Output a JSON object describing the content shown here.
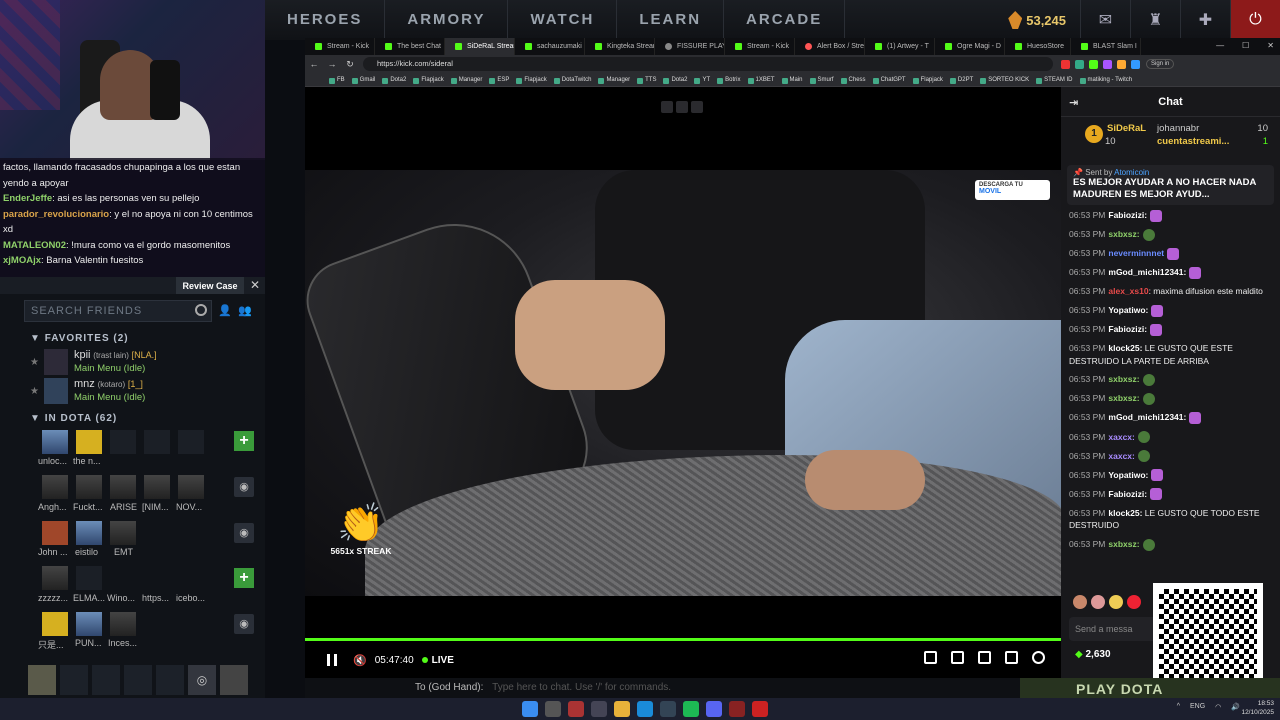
{
  "dota": {
    "nav": [
      "HEROES",
      "ARMORY",
      "WATCH",
      "LEARN",
      "ARCADE"
    ],
    "shards": "53,245"
  },
  "left_chat": [
    {
      "user": "",
      "text": "factos, llamando fracasados chupapinga a los que estan yendo a apoyar",
      "color": "#ffffff"
    },
    {
      "user": "EnderJeffe",
      "text": ": asi es las personas ven su pellejo",
      "color": "#8fd16a"
    },
    {
      "user": "parador_revolucionario",
      "text": ": y el no apoya ni con 10 centimos xd",
      "color": "#d9a34a"
    },
    {
      "user": "MATALEON02",
      "text": ": !mura como va el gordo masomenitos",
      "color": "#8fd16a"
    },
    {
      "user": "xjMOAjx",
      "text": ": Barna Valentin fuesitos",
      "color": "#8fd16a"
    }
  ],
  "friends": {
    "review_case": "Review Case",
    "search_placeholder": "SEARCH FRIENDS",
    "favorites_label": "FAVORITES (2)",
    "favorites": [
      {
        "name": "kpii",
        "sub": "(trast lain)",
        "tag": "[NLA.]",
        "status": "Main Menu (Idle)"
      },
      {
        "name": "mnz",
        "sub": "(kotaro)",
        "tag": "[1_]",
        "status": "Main Menu (Idle)"
      }
    ],
    "in_dota_label": "IN DOTA (62)",
    "tiles_row1": [
      "unloc...",
      "the n..."
    ],
    "tiles_row2": [
      "Angh...",
      "Fuckt...",
      "ARISE",
      "[NIM...",
      "NOV..."
    ],
    "tiles_row3": [
      "John ...",
      "eistilo",
      "EMT"
    ],
    "tiles_row4": [
      "zzzzz...",
      "ELMA...",
      "Wino...",
      "https...",
      "icebo..."
    ],
    "tiles_row5": [
      "只是...",
      "PUN...",
      "Inces..."
    ]
  },
  "browser": {
    "tabs": [
      "Stream - Kick",
      "The best Chat",
      "SiDeRaL Stream",
      "sachauzumaki",
      "Kingteka Stream",
      "FISSURE PLAYS",
      "Stream - Kick",
      "Alert Box / Stre",
      "(1) Artwey - T",
      "Ogre Magi - D",
      "HuesoStore",
      "BLAST Slam I"
    ],
    "url": "https://kick.com/sideral",
    "signin": "Sign in",
    "bookmarks": [
      "FB",
      "Gmail",
      "Dota2",
      "Flapjack",
      "Manager",
      "ESP",
      "Flapjack",
      "DotaTwitch",
      "Manager",
      "TTS",
      "Dota2",
      "YT",
      "Botrix",
      "1XBET",
      "Main",
      "Smurf",
      "Chess",
      "ChatGPT",
      "Flapjack",
      "D2PT",
      "SORTEO KICK",
      "STEAM ID",
      "matiking - Twitch"
    ]
  },
  "video": {
    "badge": "DESCARGA TU",
    "badge_sub": "MOVIL",
    "streak": "5651x STREAK",
    "time": "05:47:40",
    "live": "LIVE",
    "progress": 1.0
  },
  "chat": {
    "title": "Chat",
    "leaders": [
      {
        "name": "SiDeRaL",
        "count": "10"
      },
      {
        "name": "johannabr",
        "count": "10"
      },
      {
        "name": "cuentastreami...",
        "count": "1"
      }
    ],
    "pinned_sent_by": "Sent by",
    "pinned_author": "Atomicoin",
    "pinned_msg": "ES MEJOR AYUDAR A NO HACER NADA MADUREN ES MEJOR AYUD...",
    "messages": [
      {
        "ts": "06:53 PM",
        "user": "Fabiozizi:",
        "color": "#ffffff",
        "text": "",
        "emote": true
      },
      {
        "ts": "06:53 PM",
        "user": "sxbxsz:",
        "color": "#8fd16a",
        "text": "",
        "emote": true
      },
      {
        "ts": "06:53 PM",
        "user": "neverminnnet",
        "color": "#6a8cff",
        "text": "",
        "emote": true
      },
      {
        "ts": "06:53 PM",
        "user": "mGod_michi12341:",
        "color": "#ffffff",
        "text": "",
        "emote": true
      },
      {
        "ts": "06:53 PM",
        "user": "alex_xs10",
        "color": "#e84a4a",
        "text": ": maxima difusion este maldito",
        "emote": false
      },
      {
        "ts": "06:53 PM",
        "user": "Yopatiwo:",
        "color": "#ffffff",
        "text": "",
        "emote": true
      },
      {
        "ts": "06:53 PM",
        "user": "Fabiozizi:",
        "color": "#ffffff",
        "text": "",
        "emote": true
      },
      {
        "ts": "06:53 PM",
        "user": "klock25:",
        "color": "#ffffff",
        "text": " LE GUSTO QUE ESTE DESTRUIDO LA PARTE DE ARRIBA",
        "emote": false
      },
      {
        "ts": "06:53 PM",
        "user": "sxbxsz:",
        "color": "#8fd16a",
        "text": "",
        "emote": true
      },
      {
        "ts": "06:53 PM",
        "user": "sxbxsz:",
        "color": "#8fd16a",
        "text": "",
        "emote": true
      },
      {
        "ts": "06:53 PM",
        "user": "mGod_michi12341:",
        "color": "#ffffff",
        "text": "",
        "emote": true
      },
      {
        "ts": "06:53 PM",
        "user": "xaxcx:",
        "color": "#a98cff",
        "text": "",
        "emote": true
      },
      {
        "ts": "06:53 PM",
        "user": "xaxcx:",
        "color": "#a98cff",
        "text": "",
        "emote": true
      },
      {
        "ts": "06:53 PM",
        "user": "Yopatiwo:",
        "color": "#ffffff",
        "text": "",
        "emote": true
      },
      {
        "ts": "06:53 PM",
        "user": "Fabiozizi:",
        "color": "#ffffff",
        "text": "",
        "emote": true
      },
      {
        "ts": "06:53 PM",
        "user": "klock25:",
        "color": "#ffffff",
        "text": " LE GUSTO QUE TODO ESTE DESTRUIDO",
        "emote": false
      },
      {
        "ts": "06:53 PM",
        "user": "sxbxsz:",
        "color": "#8fd16a",
        "text": "",
        "emote": true
      }
    ],
    "input_placeholder": "Send a messa",
    "points": "2,630"
  },
  "dota_chat": {
    "label": "To (God Hand):",
    "hint": "Type here to chat. Use '/' for commands."
  },
  "play_dota": "PLAY DOTA",
  "taskbar": {
    "lang": "ENG",
    "time": "18:53",
    "date": "12/10/2025"
  }
}
